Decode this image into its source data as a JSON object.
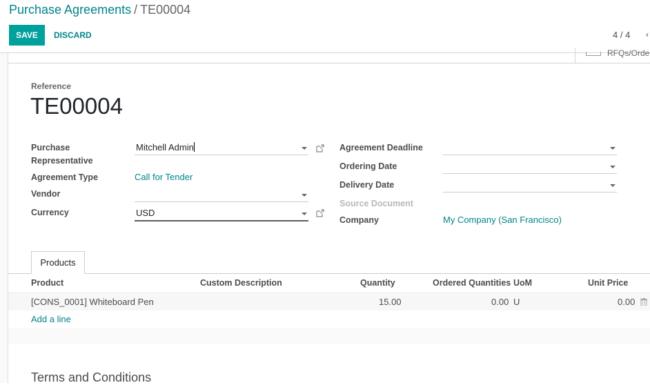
{
  "breadcrumb": {
    "parent": "Purchase Agreements",
    "separator": "/",
    "current": "TE00004"
  },
  "toolbar": {
    "save_label": "SAVE",
    "discard_label": "DISCARD"
  },
  "pager": {
    "value": "4 / 4",
    "prev_icon": "chevron-left-icon"
  },
  "smart_button": {
    "label": "RFQs/Orders",
    "icon": "list-icon"
  },
  "reference": {
    "label": "Reference",
    "value": "TE00004"
  },
  "left_fields": {
    "purchase_representative": {
      "label_line1": "Purchase",
      "label_line2": "Representative",
      "value": "Mitchell Admin"
    },
    "agreement_type": {
      "label": "Agreement Type",
      "value": "Call for Tender"
    },
    "vendor": {
      "label": "Vendor",
      "value": ""
    },
    "currency": {
      "label": "Currency",
      "value": "USD"
    }
  },
  "right_fields": {
    "agreement_deadline": {
      "label": "Agreement Deadline",
      "value": ""
    },
    "ordering_date": {
      "label": "Ordering Date",
      "value": ""
    },
    "delivery_date": {
      "label": "Delivery Date",
      "value": ""
    },
    "source_document": {
      "label": "Source Document"
    },
    "company": {
      "label": "Company",
      "value": "My Company (San Francisco)"
    }
  },
  "tabs": [
    {
      "label": "Products",
      "active": true
    }
  ],
  "products_table": {
    "columns": [
      "Product",
      "Custom Description",
      "Quantity",
      "Ordered Quantities",
      "UoM",
      "Unit Price"
    ],
    "rows": [
      {
        "product": "[CONS_0001] Whiteboard Pen",
        "custom_description": "",
        "quantity": "15.00",
        "ordered_quantities": "0.00",
        "uom": "U",
        "unit_price": "0.00"
      }
    ],
    "add_line_label": "Add a line"
  },
  "terms": {
    "heading": "Terms and Conditions"
  },
  "colors": {
    "primary": "#00a09d",
    "link": "#00848a"
  }
}
